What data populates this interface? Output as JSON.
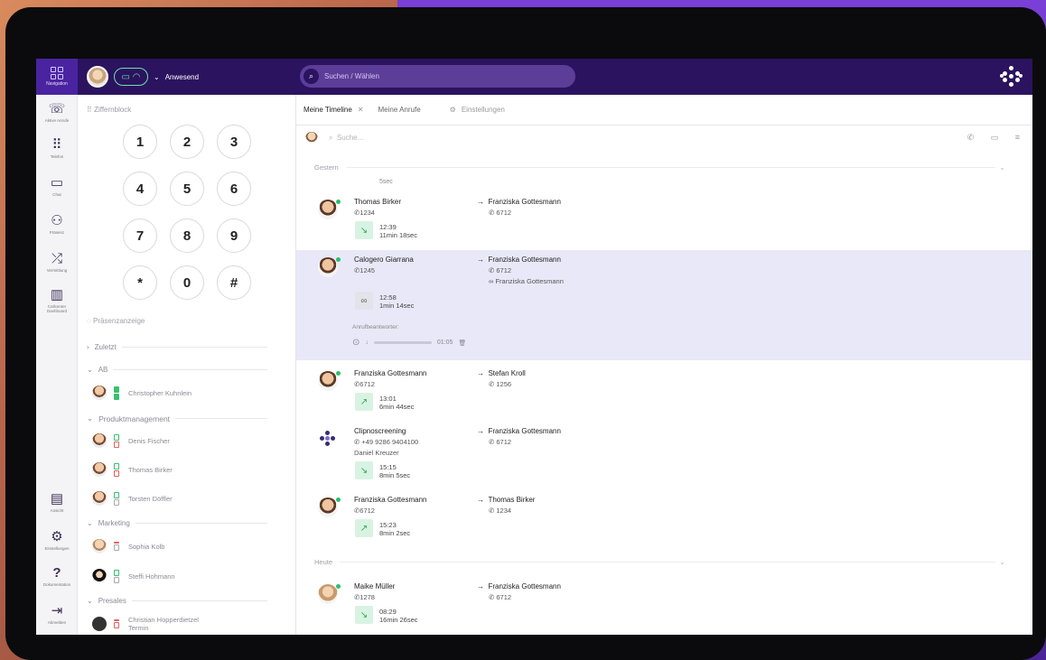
{
  "topbar": {
    "nav_label": "Navigation",
    "status": "Anwesend",
    "search_placeholder": "Suchen / Wählen"
  },
  "rail": [
    {
      "label": "Aktive Anrufe",
      "icon": "active-calls-icon"
    },
    {
      "label": "Telefon",
      "icon": "dialpad-icon"
    },
    {
      "label": "Chat",
      "icon": "chat-icon"
    },
    {
      "label": "Präsenz",
      "icon": "presence-icon"
    },
    {
      "label": "Vermittlung",
      "icon": "transfer-icon"
    },
    {
      "label": "Callcenter Dashboard",
      "icon": "dashboard-icon"
    },
    {
      "label": "Ansicht",
      "icon": "view-icon"
    },
    {
      "label": "Einstellungen",
      "icon": "gear-icon"
    },
    {
      "label": "Dokumentation",
      "icon": "help-icon"
    },
    {
      "label": "Abmelden",
      "icon": "logout-icon"
    }
  ],
  "dialpad": {
    "title": "Ziffernblock",
    "keys": [
      "1",
      "2",
      "3",
      "4",
      "5",
      "6",
      "7",
      "8",
      "9",
      "*",
      "0",
      "#"
    ]
  },
  "presence": {
    "title": "Präsenzanzeige",
    "groups": {
      "recent": "Zuletzt",
      "ab": "AB",
      "product": "Produktmanagement",
      "marketing": "Marketing",
      "presales": "Presales"
    },
    "contacts": {
      "c1": "Christopher Kuhnlein",
      "c2": "Denis Fischer",
      "c3": "Thomas Birker",
      "c4": "Torsten Döffler",
      "c5": "Sophia Kolb",
      "c6": "Steffi Hohmann",
      "c7": "Christian Hopperdietzel",
      "c7_status": "Termin"
    }
  },
  "tabs": {
    "timeline": "Meine Timeline",
    "calls": "Meine Anrufe",
    "settings": "Einstellungen"
  },
  "search": {
    "placeholder": "Suche..."
  },
  "timeline": {
    "yesterday": "Gestern",
    "today": "Heute",
    "partial_duration": "5sec",
    "calls": [
      {
        "caller": "Thomas Birker",
        "caller_num": "1234",
        "target": "Franziska Gottesmann",
        "target_num": "6712",
        "time": "12:39",
        "duration": "11min 18sec"
      },
      {
        "caller": "Calogero Giarrana",
        "caller_num": "1245",
        "target": "Franziska Gottesmann",
        "target_num": "6712",
        "forward": "Franziska Gottesmann",
        "time": "12:58",
        "duration": "1min 14sec",
        "voicemail_label": "Anrufbeantworter:",
        "voicemail_len": "01:05"
      },
      {
        "caller": "Franziska Gottesmann",
        "caller_num": "6712",
        "target": "Stefan Kroll",
        "target_num": "1256",
        "time": "13:01",
        "duration": "6min 44sec"
      },
      {
        "caller": "Clipnoscreening",
        "caller_num": "+49 9286 9404100",
        "caller_extra": "Daniel Kreuzer",
        "target": "Franziska Gottesmann",
        "target_num": "6712",
        "time": "15:15",
        "duration": "8min 5sec"
      },
      {
        "caller": "Franziska Gottesmann",
        "caller_num": "6712",
        "target": "Thomas Birker",
        "target_num": "1234",
        "time": "15:23",
        "duration": "8min 2sec"
      },
      {
        "caller": "Maike Müller",
        "caller_num": "1278",
        "target": "Franziska Gottesmann",
        "target_num": "6712",
        "time": "08:29",
        "duration": "16min 26sec"
      }
    ]
  },
  "colors": {
    "topbar": "#2b1360",
    "accent": "#4a24a0",
    "online": "#2bbf6a",
    "highlight_row": "#e9e8f8"
  }
}
